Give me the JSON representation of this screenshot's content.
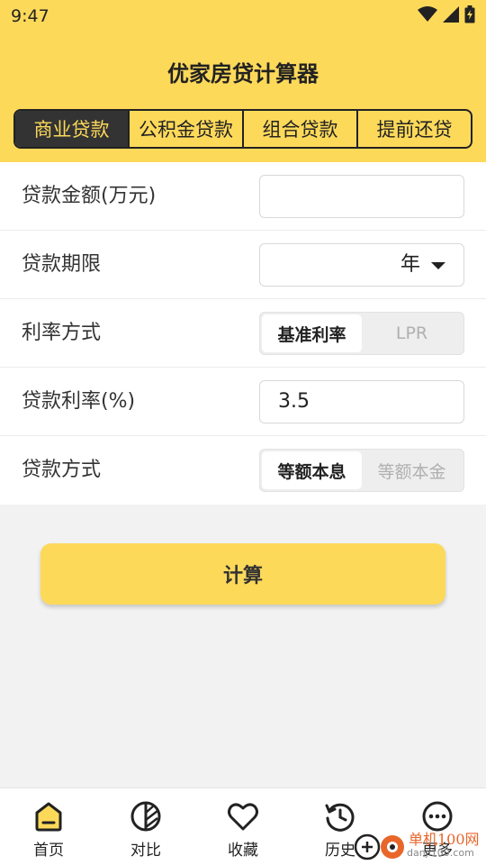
{
  "status_bar": {
    "time": "9:47",
    "icons": [
      "wifi-icon",
      "signal-icon",
      "battery-icon"
    ]
  },
  "app": {
    "title": "优家房贷计算器"
  },
  "tabs": [
    {
      "label": "商业贷款",
      "active": true
    },
    {
      "label": "公积金贷款",
      "active": false
    },
    {
      "label": "组合贷款",
      "active": false
    },
    {
      "label": "提前还贷",
      "active": false
    }
  ],
  "form": {
    "amount": {
      "label": "贷款金额(万元)",
      "value": ""
    },
    "term": {
      "label": "贷款期限",
      "value": "年"
    },
    "rate_mode": {
      "label": "利率方式",
      "options": [
        "基准利率",
        "LPR"
      ],
      "selected": "基准利率"
    },
    "rate": {
      "label": "贷款利率(%)",
      "value": "3.5"
    },
    "method": {
      "label": "贷款方式",
      "options": [
        "等额本息",
        "等额本金"
      ],
      "selected": "等额本息"
    }
  },
  "calculate_button": "计算",
  "bottom_nav": [
    {
      "label": "首页",
      "icon": "home-icon",
      "active": true
    },
    {
      "label": "对比",
      "icon": "compare-icon",
      "active": false
    },
    {
      "label": "收藏",
      "icon": "heart-icon",
      "active": false
    },
    {
      "label": "历史",
      "icon": "history-icon",
      "active": false
    },
    {
      "label": "更多",
      "icon": "more-icon",
      "active": false
    }
  ],
  "watermark": {
    "text": "单机100网",
    "sub": "danji100.com"
  },
  "colors": {
    "accent": "#fdd95a",
    "dark": "#333333",
    "background": "#f2f2f2"
  }
}
